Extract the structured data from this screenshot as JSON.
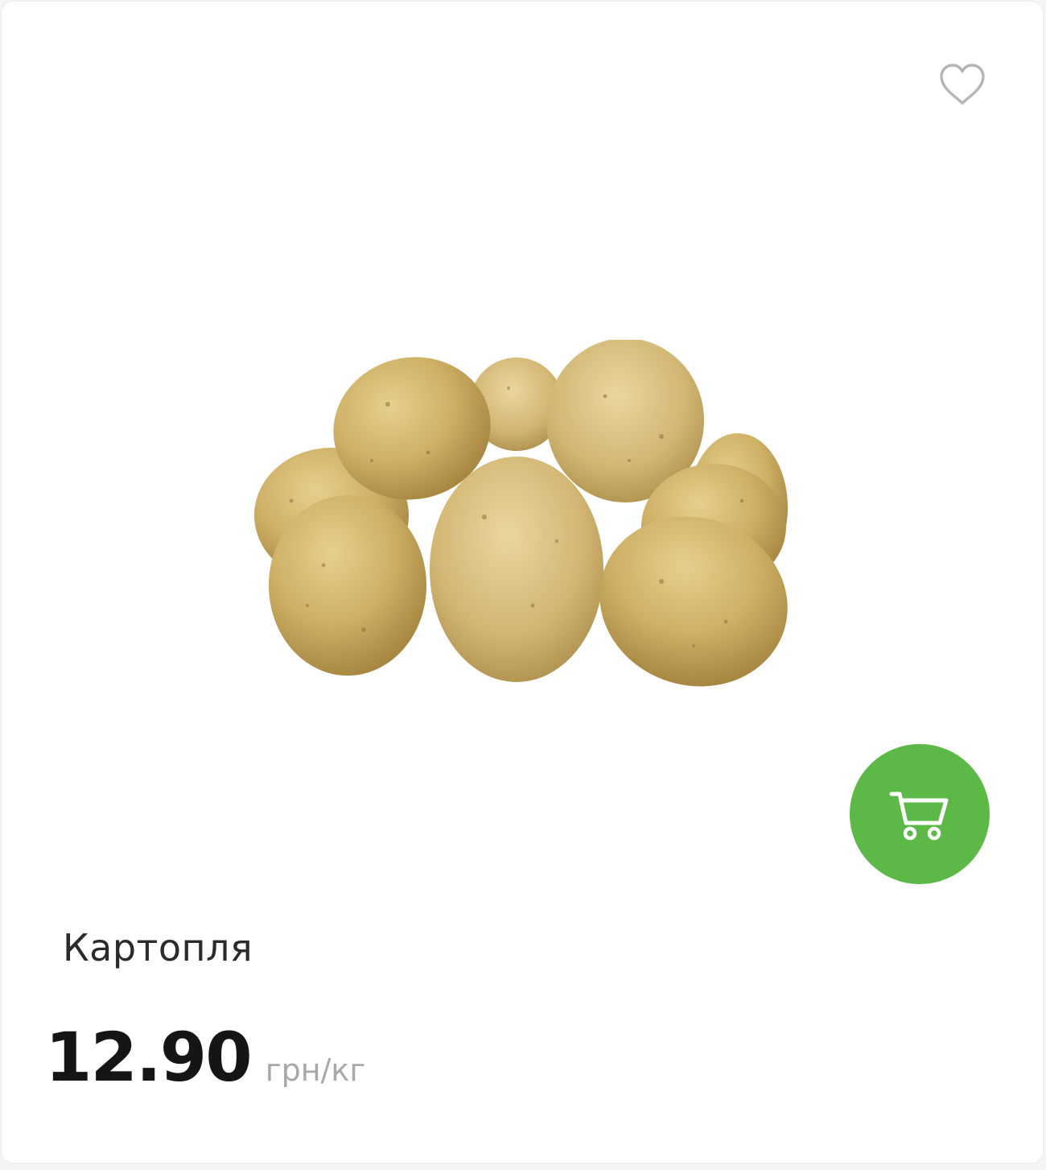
{
  "product": {
    "name": "Картопля",
    "price": "12.90",
    "unit": "грн/кг",
    "image_icon": "potatoes-image"
  },
  "actions": {
    "favorite_icon": "heart-outline-icon",
    "cart_icon": "shopping-cart-icon"
  },
  "colors": {
    "accent": "#5cb847",
    "price_text": "#151515",
    "unit_text": "#a8a8a8",
    "favorite_icon": "#b5b5b5"
  }
}
